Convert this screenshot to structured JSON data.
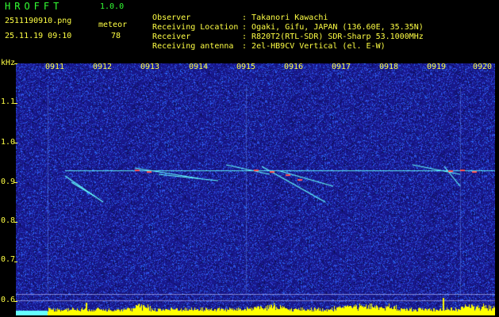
{
  "app": {
    "title": "HROFFT",
    "version": "1.0.0"
  },
  "file": {
    "name": "2511190910.png",
    "datetime": "25.11.19 09:10"
  },
  "meteor": {
    "label": "meteor",
    "count": "78"
  },
  "info": [
    {
      "key": "Observer",
      "value": "Takanori Kawachi"
    },
    {
      "key": "Receiving Location",
      "value": "Ogaki, Gifu, JAPAN (136.60E, 35.35N)"
    },
    {
      "key": "Receiver",
      "value": "R820T2(RTL-SDR) SDR-Sharp 53.1000MHz"
    },
    {
      "key": "Receiving antenna",
      "value": "2el-HB9CV Vertical (el. E-W)"
    }
  ],
  "axis": {
    "unit": "kHz",
    "y_labels": [
      "1.1",
      "1.0",
      "0.9",
      "0.8",
      "0.7",
      "0.6"
    ],
    "x_labels": [
      "0911",
      "0912",
      "0913",
      "0914",
      "0915",
      "0916",
      "0917",
      "0918",
      "0919",
      "0920"
    ]
  },
  "colors": {
    "noise_background": "#1a1a8c",
    "noise_speckle": "#3c78ff",
    "signal": "#66ffff",
    "echo_hot": "#ff5050",
    "meteor_bar": "#ffff00",
    "text": "#ffff44",
    "title": "#33ff33"
  }
}
